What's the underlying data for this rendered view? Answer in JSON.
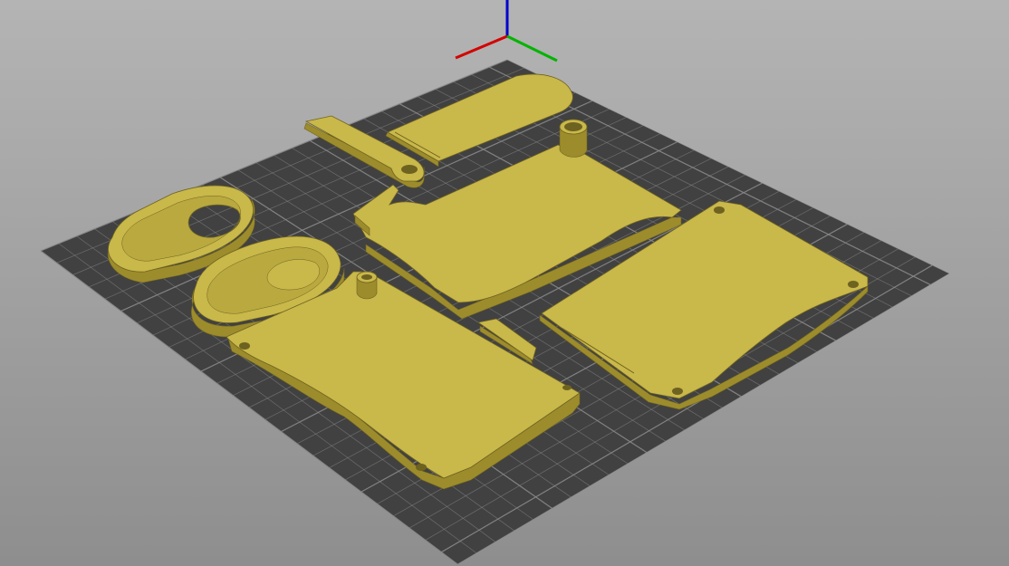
{
  "app": {
    "view": "3D preview",
    "object_count": 8
  },
  "colors": {
    "background_top": "#b4b4b4",
    "background_bottom": "#8e8e8e",
    "bed": "#414141",
    "bed_grid": "#8a8a8a",
    "part_fill": "#c9b84a",
    "part_side": "#9c8c2c",
    "part_edge": "#6e6220",
    "axis_x": "#d40000",
    "axis_y": "#00b400",
    "axis_z": "#0000cc"
  },
  "icons": {
    "axes": "xyz-axes-icon"
  },
  "objects": [
    "oval-ring-small",
    "oval-ring-large",
    "strap-arm",
    "lid-plate",
    "middle-shell",
    "bottom-shell",
    "right-plate",
    "clip-small"
  ]
}
